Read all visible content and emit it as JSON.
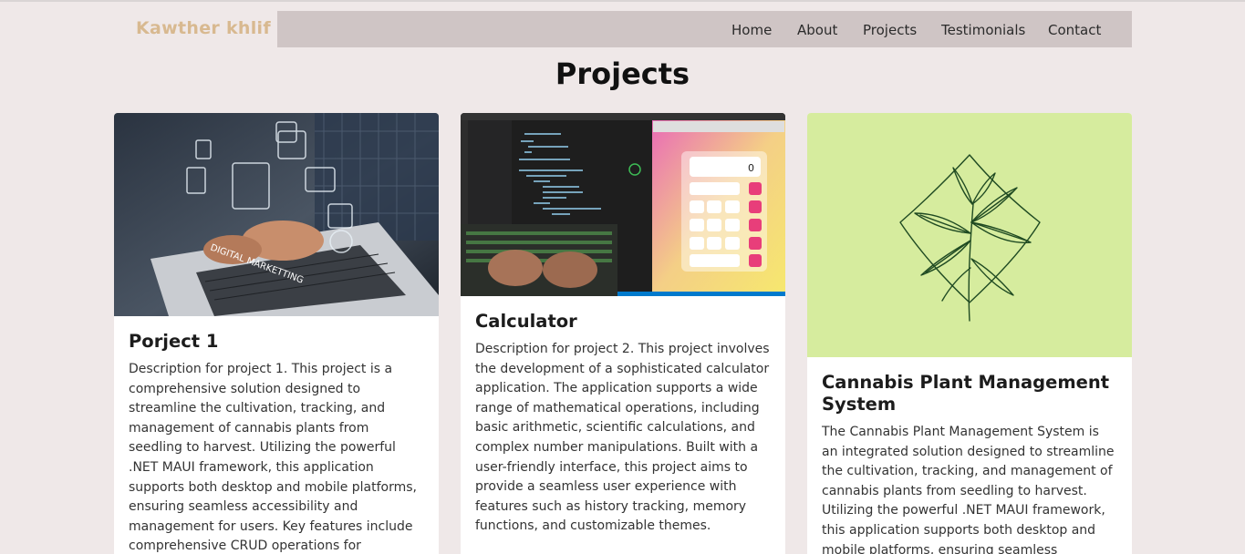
{
  "header": {
    "brand": "Kawther khlif",
    "nav": [
      {
        "label": "Home"
      },
      {
        "label": "About"
      },
      {
        "label": "Projects"
      },
      {
        "label": "Testimonials"
      },
      {
        "label": "Contact"
      }
    ]
  },
  "section": {
    "title": "Projects"
  },
  "projects": [
    {
      "title": "Porject 1",
      "image": "digital-marketing-laptop-photo",
      "image_text": "DIGITAL MARKETTING",
      "description": "Description for project 1. This project is a comprehensive solution designed to streamline the cultivation, tracking, and management of cannabis plants from seedling to harvest. Utilizing the powerful .NET MAUI framework, this application supports both desktop and mobile platforms, ensuring seamless accessibility and management for users. Key features include comprehensive CRUD operations for managing plant varieties, stages"
    },
    {
      "title": "Calculator",
      "image": "calculator-code-screenshot",
      "image_display": "0",
      "description": "Description for project 2. This project involves the development of a sophisticated calculator application. The application supports a wide range of mathematical operations, including basic arithmetic, scientific calculations, and complex number manipulations. Built with a user-friendly interface, this project aims to provide a seamless user experience with features such as history tracking, memory functions, and customizable themes."
    },
    {
      "title": "Cannabis Plant Management System",
      "image": "cannabis-plant-line-art",
      "description": "The Cannabis Plant Management System is an integrated solution designed to streamline the cultivation, tracking, and management of cannabis plants from seedling to harvest. Utilizing the powerful .NET MAUI framework, this application supports both desktop and mobile platforms, ensuring seamless"
    }
  ],
  "colors": {
    "page_bg": "#efe8e8",
    "navbar_bg": "#cfc5c5",
    "brand": "#d8b990",
    "plant_bg": "#d6ec9e"
  }
}
